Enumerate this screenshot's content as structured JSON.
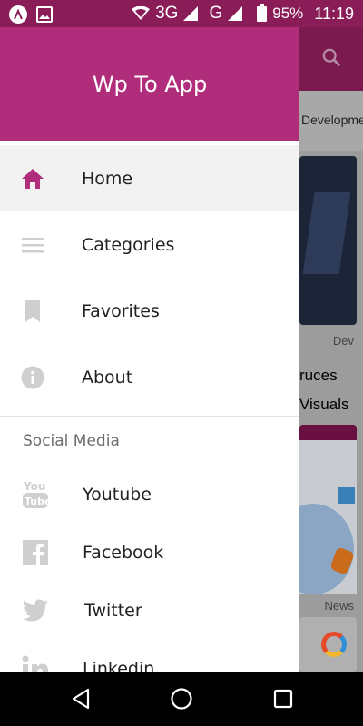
{
  "status_bar": {
    "network_3g": "3G",
    "network_g": "G",
    "battery": "95%",
    "time": "11:19"
  },
  "background_app": {
    "tab_partial": "Developme",
    "category_partial": "Dev",
    "title_line1": "ruces",
    "title_line2": "Visuals",
    "category2_partial": "News"
  },
  "drawer": {
    "title": "Wp To App",
    "accent_color": "#b02d7c",
    "items": [
      {
        "label": "Home",
        "icon": "home-icon",
        "active": true
      },
      {
        "label": "Categories",
        "icon": "menu-icon",
        "active": false
      },
      {
        "label": "Favorites",
        "icon": "bookmark-icon",
        "active": false
      },
      {
        "label": "About",
        "icon": "info-icon",
        "active": false
      }
    ],
    "section_label": "Social Media",
    "social": [
      {
        "label": "Youtube",
        "icon": "youtube-icon"
      },
      {
        "label": "Facebook",
        "icon": "facebook-icon"
      },
      {
        "label": "Twitter",
        "icon": "twitter-icon"
      },
      {
        "label": "Linkedin",
        "icon": "linkedin-icon"
      }
    ]
  },
  "nav_bar": {
    "back": "back-icon",
    "home": "home-circle-icon",
    "recents": "recents-icon"
  }
}
